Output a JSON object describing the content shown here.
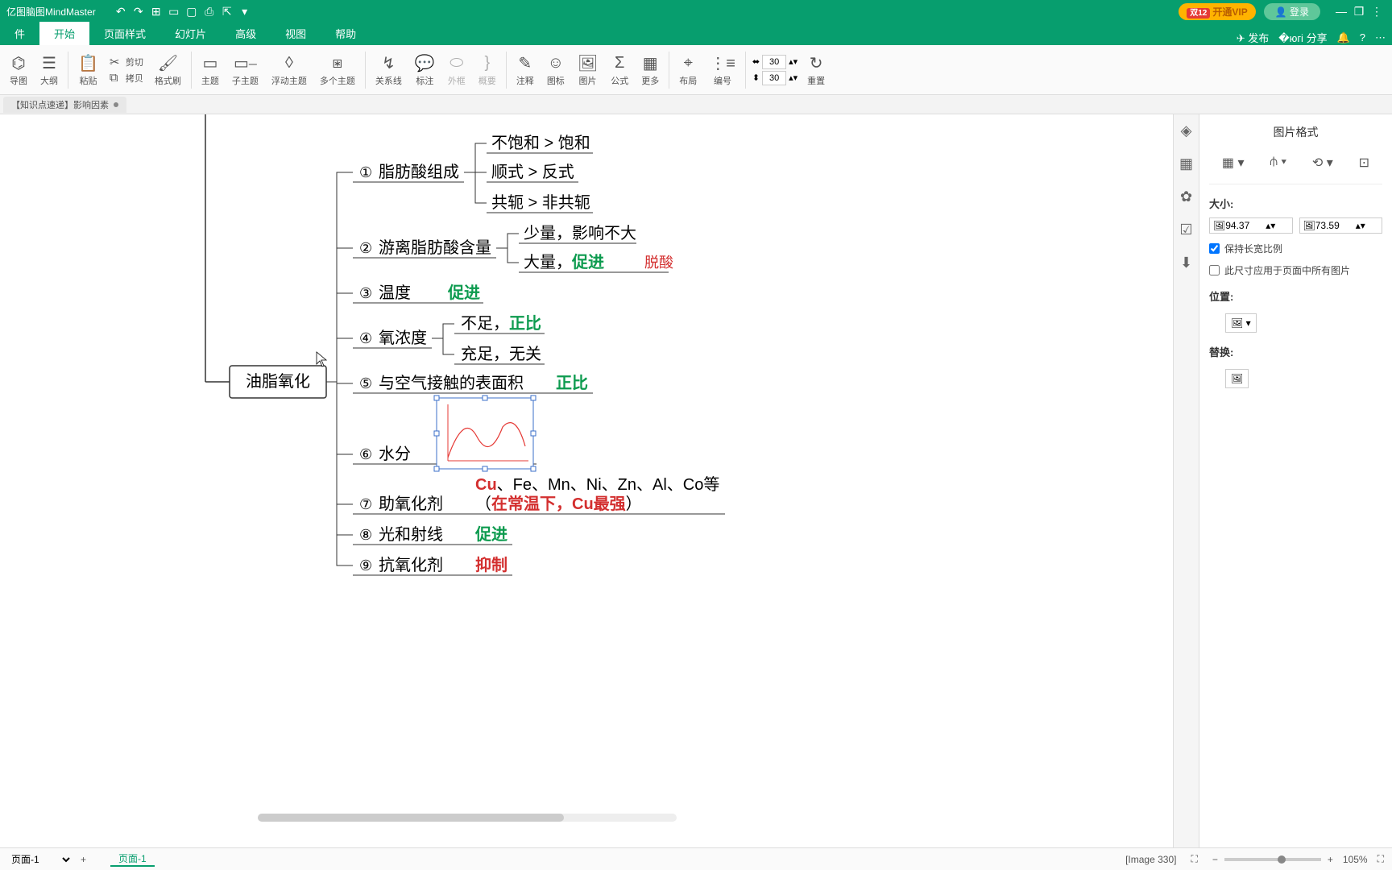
{
  "app": {
    "name": "亿图脑图MindMaster"
  },
  "titlebar": {
    "vip_badge": "双12",
    "vip_text": "开通VIP",
    "login": "登录"
  },
  "menubar": {
    "tabs": [
      "件",
      "开始",
      "页面样式",
      "幻灯片",
      "高级",
      "视图",
      "帮助"
    ],
    "active_index": 1,
    "publish": "发布",
    "share": "分享"
  },
  "ribbon": {
    "mindmap": "导图",
    "outline": "大纲",
    "paste": "粘贴",
    "cut": "剪切",
    "copy": "拷贝",
    "format_painter": "格式刷",
    "topic": "主题",
    "subtopic": "子主题",
    "floating": "浮动主题",
    "multi": "多个主题",
    "relation": "关系线",
    "callout": "标注",
    "boundary": "外框",
    "summary": "概要",
    "note": "注释",
    "icon": "图标",
    "image": "图片",
    "formula": "公式",
    "more": "更多",
    "layout": "布局",
    "numbering": "编号",
    "width_val": "30",
    "height_val": "30",
    "reset": "重置"
  },
  "doc_tab": "【知识点速递】影响因素",
  "mindmap": {
    "root": "油脂氧化",
    "n1": {
      "num": "①",
      "label": "脂肪酸组成",
      "c1": "不饱和 > 饱和",
      "c2": "顺式 > 反式",
      "c3": "共轭 > 非共轭"
    },
    "n2": {
      "num": "②",
      "label": "游离脂肪酸含量",
      "c1": "少量，影响不大",
      "c2a": "大量，",
      "c2b": "促进",
      "c2note": "脱酸"
    },
    "n3": {
      "num": "③",
      "label": "温度",
      "eff": "促进"
    },
    "n4": {
      "num": "④",
      "label": "氧浓度",
      "c1a": "不足，",
      "c1b": "正比",
      "c2": "充足，无关"
    },
    "n5": {
      "num": "⑤",
      "label": "与空气接触的表面积",
      "eff": "正比"
    },
    "n6": {
      "num": "⑥",
      "label": "水分"
    },
    "n7": {
      "num": "⑦",
      "label": "助氧化剂",
      "line1a": "Cu",
      "line1b": "、Fe、Mn、Ni、Zn、Al、Co等",
      "line2a": "（",
      "line2b": "在常温下，Cu最强",
      "line2c": "）"
    },
    "n8": {
      "num": "⑧",
      "label": "光和射线",
      "eff": "促进"
    },
    "n9": {
      "num": "⑨",
      "label": "抗氧化剂",
      "eff": "抑制"
    }
  },
  "panel": {
    "title": "图片格式",
    "size": "大小:",
    "width": "94.37",
    "height": "73.59",
    "keep_ratio": "保持长宽比例",
    "apply_all": "此尺寸应用于页面中所有图片",
    "position": "位置:",
    "replace": "替换:"
  },
  "status": {
    "page_sel": "页面-1",
    "page_tab": "页面-1",
    "image_info": "[Image 330]",
    "zoom": "105%"
  }
}
